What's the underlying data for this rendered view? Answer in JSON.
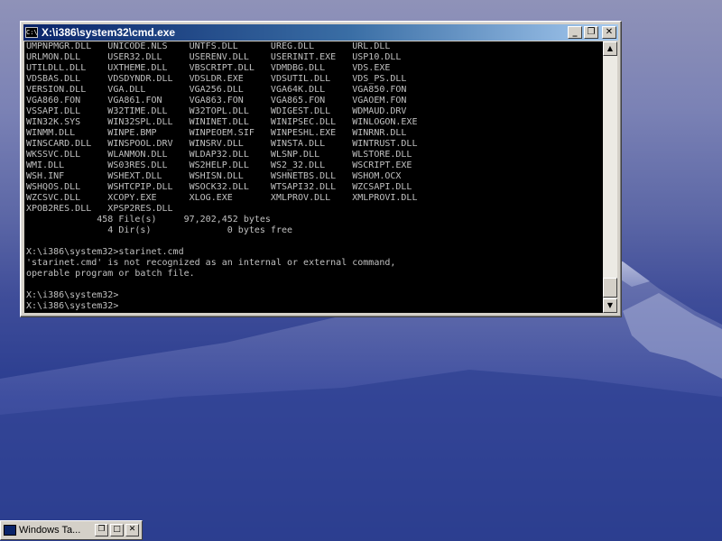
{
  "window": {
    "title": "X:\\i386\\system32\\cmd.exe",
    "app_icon_text": "C:\\",
    "minimize_glyph": "_",
    "restore_glyph": "❐",
    "close_glyph": "✕"
  },
  "console": {
    "lines": [
      "UMPNPMGR.DLL   UNICODE.NLS    UNTFS.DLL      UREG.DLL       URL.DLL",
      "URLMON.DLL     USER32.DLL     USERENV.DLL    USERINIT.EXE   USP10.DLL",
      "UTILDLL.DLL    UXTHEME.DLL    VBSCRIPT.DLL   VDMDBG.DLL     VDS.EXE",
      "VDSBAS.DLL     VDSDYNDR.DLL   VDSLDR.EXE     VDSUTIL.DLL    VDS_PS.DLL",
      "VERSION.DLL    VGA.DLL        VGA256.DLL     VGA64K.DLL     VGA850.FON",
      "VGA860.FON     VGA861.FON     VGA863.FON     VGA865.FON     VGAOEM.FON",
      "VSSAPI.DLL     W32TIME.DLL    W32TOPL.DLL    WDIGEST.DLL    WDMAUD.DRV",
      "WIN32K.SYS     WIN32SPL.DLL   WININET.DLL    WINIPSEC.DLL   WINLOGON.EXE",
      "WINMM.DLL      WINPE.BMP      WINPEOEM.SIF   WINPESHL.EXE   WINRNR.DLL",
      "WINSCARD.DLL   WINSPOOL.DRV   WINSRV.DLL     WINSTA.DLL     WINTRUST.DLL",
      "WKSSVC.DLL     WLANMON.DLL    WLDAP32.DLL    WLSNP.DLL      WLSTORE.DLL",
      "WMI.DLL        WS03RES.DLL    WS2HELP.DLL    WS2_32.DLL     WSCRIPT.EXE",
      "WSH.INF        WSHEXT.DLL     WSHISN.DLL     WSHNETBS.DLL   WSHOM.OCX",
      "WSHQOS.DLL     WSHTCPIP.DLL   WSOCK32.DLL    WTSAPI32.DLL   WZCSAPI.DLL",
      "WZCSVC.DLL     XCOPY.EXE      XLOG.EXE       XMLPROV.DLL    XMLPROVI.DLL",
      "XPOB2RES.DLL   XPSP2RES.DLL",
      "             458 File(s)     97,202,452 bytes",
      "               4 Dir(s)              0 bytes free",
      "",
      "X:\\i386\\system32>starinet.cmd",
      "'starinet.cmd' is not recognized as an internal or external command,",
      "operable program or batch file.",
      "",
      "X:\\i386\\system32>",
      "X:\\i386\\system32>"
    ]
  },
  "scrollbar": {
    "up_glyph": "▲",
    "down_glyph": "▼"
  },
  "taskbar": {
    "item_label": "Windows Ta...",
    "restore_glyph": "❐",
    "maximize_glyph": "□",
    "close_glyph": "✕"
  }
}
